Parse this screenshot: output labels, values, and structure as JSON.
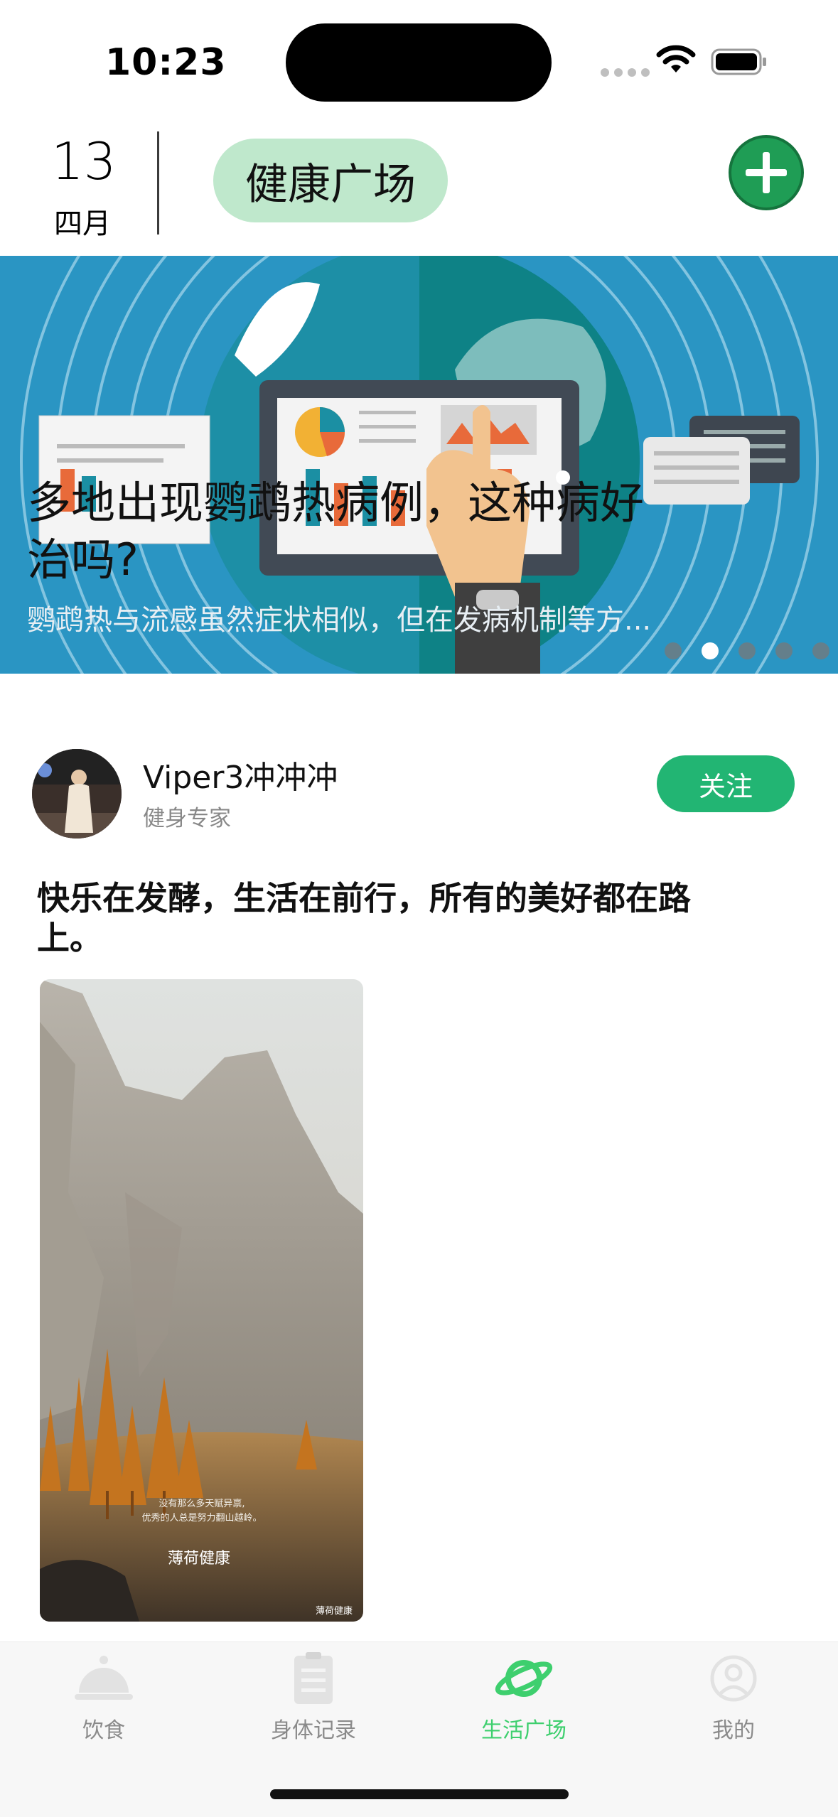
{
  "status_bar": {
    "time": "10:23"
  },
  "header": {
    "day": "13",
    "month": "四月",
    "title": "健康广场",
    "add_icon": "plus-circle-icon",
    "accent_color": "#1f9d55"
  },
  "banner": {
    "title": "多地出现鹦鹉热病例，这种病好治吗?",
    "subtitle": "鹦鹉热与流感虽然症状相似，但在发病机制等方...",
    "page_count": 5,
    "active_index": 1
  },
  "post": {
    "author_name": "Viper3冲冲冲",
    "author_title": "健身专家",
    "follow_label": "关注",
    "text": "快乐在发酵，生活在前行，所有的美好都在路上。",
    "image": {
      "caption_line1": "没有那么多天赋异禀,",
      "caption_line2": "优秀的人总是努力翻山越岭。",
      "brand": "薄荷健康",
      "watermark": "薄荷健康"
    }
  },
  "tabbar": {
    "items": [
      {
        "label": "饮食",
        "icon": "food-cloche-icon"
      },
      {
        "label": "身体记录",
        "icon": "clipboard-icon"
      },
      {
        "label": "生活广场",
        "icon": "planet-icon",
        "active": true
      },
      {
        "label": "我的",
        "icon": "user-profile-icon"
      }
    ],
    "active_color": "#3ecf6e"
  }
}
